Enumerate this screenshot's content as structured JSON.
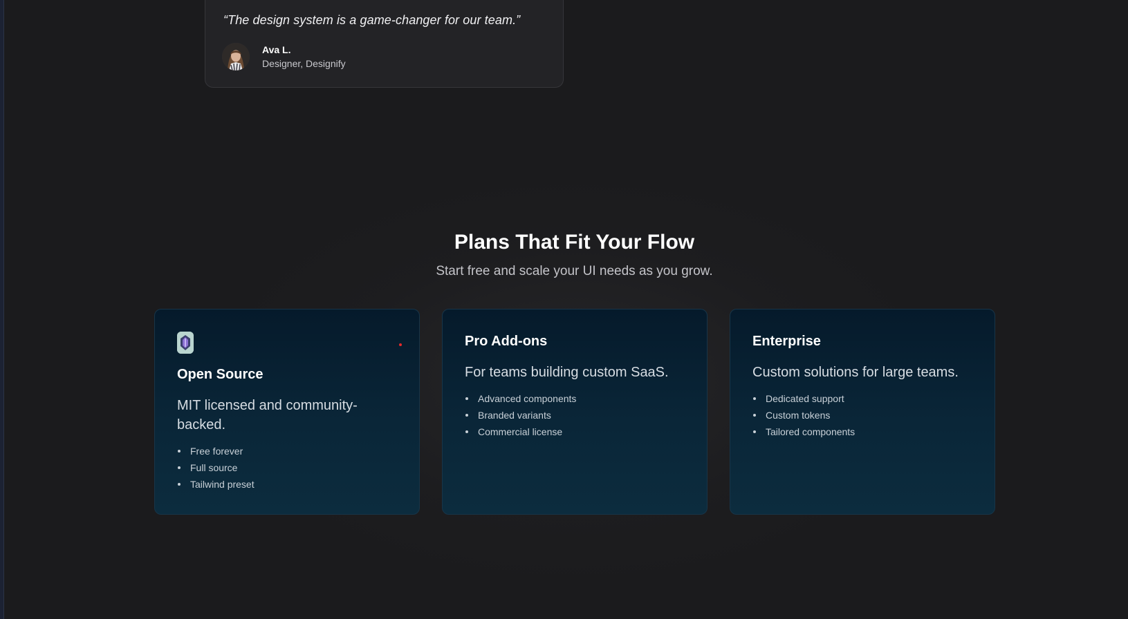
{
  "testimonial": {
    "quote": "“The design system is a game-changer for our team.”",
    "author_name": "Ava L.",
    "author_role": "Designer, Designify"
  },
  "pricing": {
    "title": "Plans That Fit Your Flow",
    "subtitle": "Start free and scale your UI needs as you grow.",
    "plans": [
      {
        "icon": "logo-icon",
        "title": "Open Source",
        "description": "MIT licensed and community-backed.",
        "features": [
          "Free forever",
          "Full source",
          "Tailwind preset"
        ]
      },
      {
        "title": "Pro Add-ons",
        "description": "For teams building custom SaaS.",
        "features": [
          "Advanced components",
          "Branded variants",
          "Commercial license"
        ]
      },
      {
        "title": "Enterprise",
        "description": "Custom solutions for large teams.",
        "features": [
          "Dedicated support",
          "Custom tokens",
          "Tailored components"
        ]
      }
    ]
  },
  "colors": {
    "background": "#1b1b1d",
    "card_gradient_top": "#051a2b",
    "card_gradient_bottom": "#0c2c3e",
    "accent_dot": "#e52a2a"
  }
}
